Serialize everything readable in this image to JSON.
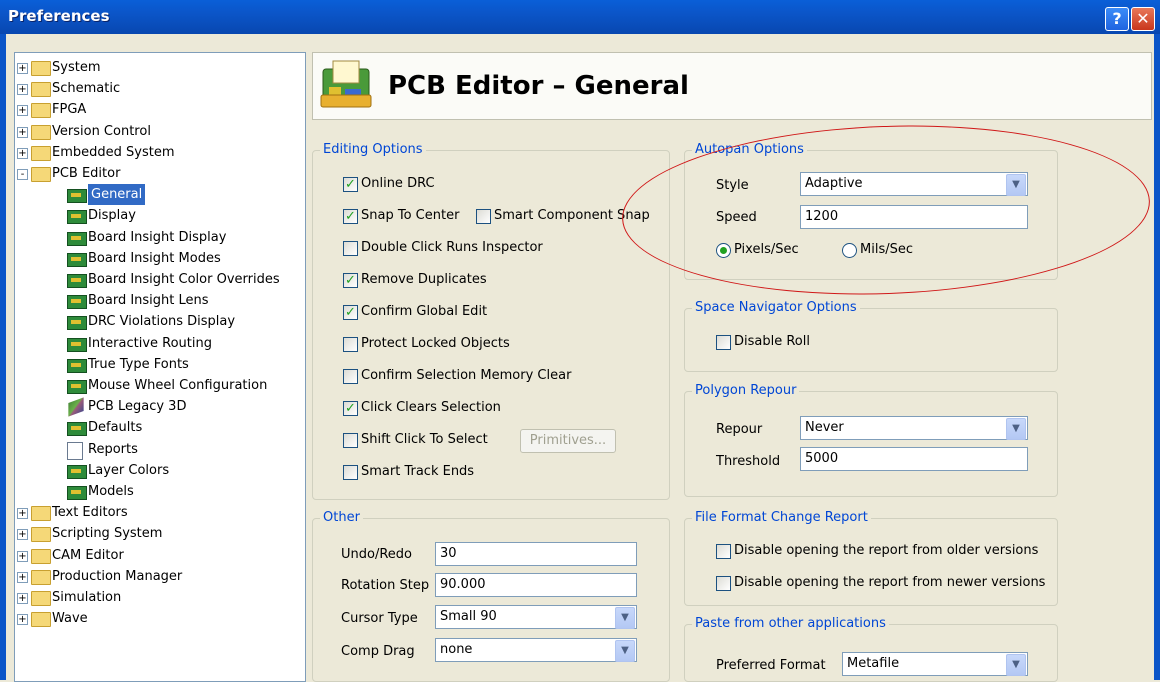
{
  "window": {
    "title": "Preferences"
  },
  "tree": {
    "items": [
      {
        "label": "System"
      },
      {
        "label": "Schematic"
      },
      {
        "label": "FPGA"
      },
      {
        "label": "Version Control"
      },
      {
        "label": "Embedded System"
      },
      {
        "label": "PCB Editor"
      },
      {
        "label": "General"
      },
      {
        "label": "Display"
      },
      {
        "label": "Board Insight Display"
      },
      {
        "label": "Board Insight Modes"
      },
      {
        "label": "Board Insight Color Overrides"
      },
      {
        "label": "Board Insight Lens"
      },
      {
        "label": "DRC Violations Display"
      },
      {
        "label": "Interactive Routing"
      },
      {
        "label": "True Type Fonts"
      },
      {
        "label": "Mouse Wheel Configuration"
      },
      {
        "label": "PCB Legacy 3D"
      },
      {
        "label": "Defaults"
      },
      {
        "label": "Reports"
      },
      {
        "label": "Layer Colors"
      },
      {
        "label": "Models"
      },
      {
        "label": "Text Editors"
      },
      {
        "label": "Scripting System"
      },
      {
        "label": "CAM Editor"
      },
      {
        "label": "Production Manager"
      },
      {
        "label": "Simulation"
      },
      {
        "label": "Wave"
      }
    ],
    "selected": "General"
  },
  "header": {
    "title": "PCB Editor – General"
  },
  "editing": {
    "title": "Editing Options",
    "online_drc": {
      "label": "Online DRC",
      "checked": true
    },
    "snap_to_center": {
      "label": "Snap To Center",
      "checked": true
    },
    "smart_component_snap": {
      "label": "Smart Component Snap",
      "checked": false
    },
    "double_click": {
      "label": "Double Click Runs Inspector",
      "checked": false
    },
    "remove_duplicates": {
      "label": "Remove Duplicates",
      "checked": true
    },
    "confirm_global_edit": {
      "label": "Confirm Global Edit",
      "checked": true
    },
    "protect_locked": {
      "label": "Protect Locked Objects",
      "checked": false
    },
    "confirm_selection": {
      "label": "Confirm Selection Memory Clear",
      "checked": false
    },
    "click_clears": {
      "label": "Click Clears Selection",
      "checked": true
    },
    "shift_click": {
      "label": "Shift Click To Select",
      "checked": false
    },
    "primitives_button": "Primitives...",
    "smart_track_ends": {
      "label": "Smart Track Ends",
      "checked": false
    }
  },
  "other": {
    "title": "Other",
    "undo_label": "Undo/Redo",
    "undo_value": "30",
    "rotation_label": "Rotation Step",
    "rotation_value": "90.000",
    "cursor_label": "Cursor Type",
    "cursor_value": "Small 90",
    "compdrag_label": "Comp Drag",
    "compdrag_value": "none"
  },
  "autopan": {
    "title": "Autopan Options",
    "style_label": "Style",
    "style_value": "Adaptive",
    "speed_label": "Speed",
    "speed_value": "1200",
    "pixels_label": "Pixels/Sec",
    "mils_label": "Mils/Sec",
    "selected_unit": "Pixels/Sec"
  },
  "space_nav": {
    "title": "Space Navigator Options",
    "disable_roll": "Disable Roll"
  },
  "polygon": {
    "title": "Polygon Repour",
    "repour_label": "Repour",
    "repour_value": "Never",
    "threshold_label": "Threshold",
    "threshold_value": "5000"
  },
  "file_format": {
    "title": "File Format Change Report",
    "older": "Disable opening the report from older versions",
    "newer": "Disable opening the report from newer versions"
  },
  "paste": {
    "title": "Paste from other applications",
    "preferred_label": "Preferred Format",
    "preferred_value": "Metafile"
  },
  "colors": {
    "accent": "#316ac5",
    "group_title": "#0046d5",
    "annotation": "#d01818"
  }
}
